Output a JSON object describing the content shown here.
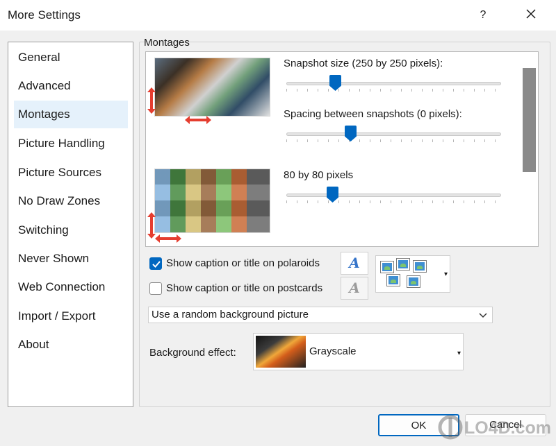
{
  "window": {
    "title": "More Settings",
    "help_label": "?"
  },
  "sidebar": {
    "items": [
      {
        "label": "General"
      },
      {
        "label": "Advanced"
      },
      {
        "label": "Montages"
      },
      {
        "label": "Picture Handling"
      },
      {
        "label": "Picture Sources"
      },
      {
        "label": "No Draw Zones"
      },
      {
        "label": "Switching"
      },
      {
        "label": "Never Shown"
      },
      {
        "label": "Web Connection"
      },
      {
        "label": "Import / Export"
      },
      {
        "label": "About"
      }
    ]
  },
  "montages": {
    "section_title": "Montages",
    "snapshot_label": "Snapshot size (250 by 250 pixels):",
    "spacing_label": "Spacing between snapshots (0 pixels):",
    "thumbnail_label": "80 by 80 pixels",
    "snapshot_value_fraction": 0.23,
    "spacing_value_fraction": 0.29,
    "thumbnail_value_fraction": 0.21
  },
  "options": {
    "polaroids_label": "Show caption or title on polaroids",
    "postcards_label": "Show caption or title on postcards",
    "font_label": "A",
    "background_picture": "Use a random background picture",
    "background_effect_label": "Background effect:",
    "background_effect_value": "Grayscale"
  },
  "buttons": {
    "ok": "OK",
    "cancel": "Cancel"
  },
  "watermark": "LO4D.com",
  "colors": {
    "accent": "#0067c0",
    "selection": "#e5f1fb",
    "arrow": "#e53d2f"
  },
  "icons": [
    "close-icon",
    "chevron-down-icon",
    "font-icon",
    "photo-icon",
    "arrow-icon"
  ]
}
